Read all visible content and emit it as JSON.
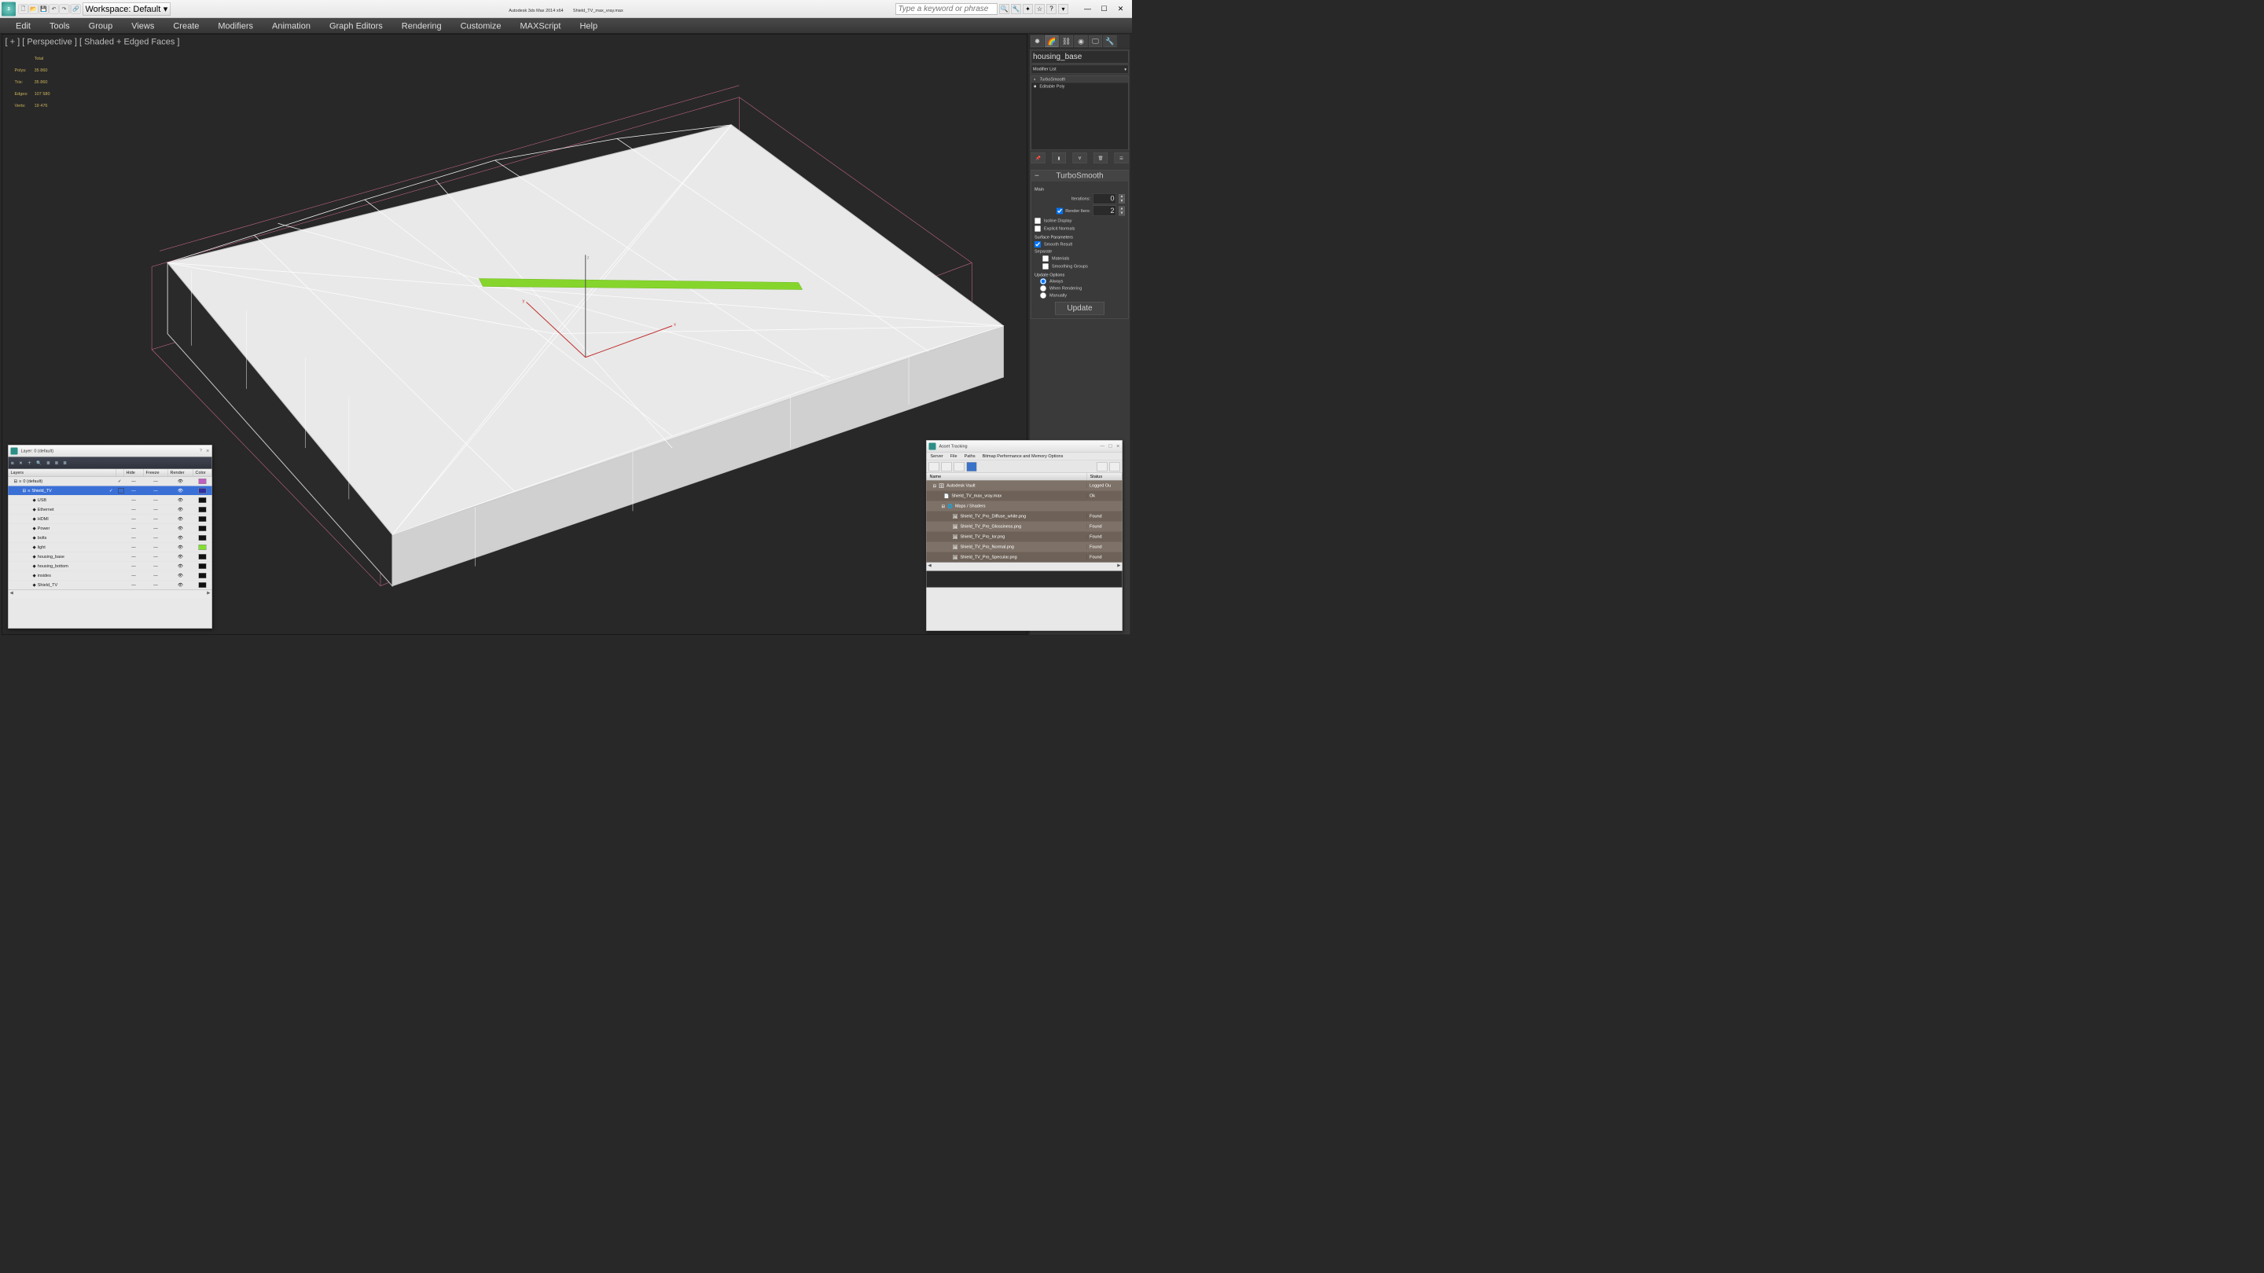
{
  "title": {
    "app": "Autodesk 3ds Max 2014 x64",
    "file": "Shield_TV_max_vray.max"
  },
  "workspace": {
    "label": "Workspace: Default"
  },
  "search": {
    "placeholder": "Type a keyword or phrase"
  },
  "menu": [
    "Edit",
    "Tools",
    "Group",
    "Views",
    "Create",
    "Modifiers",
    "Animation",
    "Graph Editors",
    "Rendering",
    "Customize",
    "MAXScript",
    "Help"
  ],
  "viewport_label": "[ + ] [ Perspective ] [ Shaded + Edged Faces ]",
  "stats": {
    "head": "Total",
    "rows": [
      {
        "k": "Polys:",
        "v": "35 860"
      },
      {
        "k": "Tris:",
        "v": "35 860"
      },
      {
        "k": "Edges:",
        "v": "107 580"
      },
      {
        "k": "Verts:",
        "v": "19 476"
      }
    ]
  },
  "cmd": {
    "object_name": "housing_base",
    "modifier_list": "Modifier List",
    "stack": [
      {
        "icon": "◐",
        "name": "TurboSmooth",
        "sel": true
      },
      {
        "icon": "■",
        "name": "Editable Poly",
        "sel": false
      }
    ],
    "rollout_title": "TurboSmooth",
    "main": "Main",
    "iter_label": "Iterations:",
    "iter_val": "0",
    "render_iter_label": "Render Iters:",
    "render_iter_val": "2",
    "isoline": "Isoline Display",
    "explicit": "Explicit Normals",
    "surface_params": "Surface Parameters",
    "smooth_result": "Smooth Result",
    "separate": "Separate",
    "materials": "Materials",
    "smoothing_groups": "Smoothing Groups",
    "update_options": "Update Options",
    "always": "Always",
    "when_rendering": "When Rendering",
    "manually": "Manually",
    "update": "Update"
  },
  "layers": {
    "title": "Layer: 0 (default)",
    "headers": {
      "layers": "Layers",
      "hide": "Hide",
      "freeze": "Freeze",
      "render": "Render",
      "color": "Color"
    },
    "rows": [
      {
        "indent": 0,
        "exp": "⊟",
        "ic": "≡",
        "name": "0 (default)",
        "chk": true,
        "hide": "—",
        "freeze": "—",
        "render": "👁",
        "color": "#c060c0",
        "sel": false
      },
      {
        "indent": 1,
        "exp": "⊟",
        "ic": "≡",
        "name": "Shield_TV",
        "chk": true,
        "box": true,
        "hide": "—",
        "freeze": "—",
        "render": "👁",
        "color": "#3030a0",
        "sel": true
      },
      {
        "indent": 2,
        "exp": "",
        "ic": "◆",
        "name": "USB",
        "hide": "—",
        "freeze": "—",
        "render": "👁",
        "color": "#101010"
      },
      {
        "indent": 2,
        "exp": "",
        "ic": "◆",
        "name": "Ethernet",
        "hide": "—",
        "freeze": "—",
        "render": "👁",
        "color": "#101010"
      },
      {
        "indent": 2,
        "exp": "",
        "ic": "◆",
        "name": "HDMI",
        "hide": "—",
        "freeze": "—",
        "render": "👁",
        "color": "#101010"
      },
      {
        "indent": 2,
        "exp": "",
        "ic": "◆",
        "name": "Power",
        "hide": "—",
        "freeze": "—",
        "render": "👁",
        "color": "#101010"
      },
      {
        "indent": 2,
        "exp": "",
        "ic": "◆",
        "name": "bolts",
        "hide": "—",
        "freeze": "—",
        "render": "👁",
        "color": "#101010"
      },
      {
        "indent": 2,
        "exp": "",
        "ic": "◆",
        "name": "light",
        "hide": "—",
        "freeze": "—",
        "render": "👁",
        "color": "#80e030"
      },
      {
        "indent": 2,
        "exp": "",
        "ic": "◆",
        "name": "housing_base",
        "hide": "—",
        "freeze": "—",
        "render": "👁",
        "color": "#101010"
      },
      {
        "indent": 2,
        "exp": "",
        "ic": "◆",
        "name": "housing_bottom",
        "hide": "—",
        "freeze": "—",
        "render": "👁",
        "color": "#101010"
      },
      {
        "indent": 2,
        "exp": "",
        "ic": "◆",
        "name": "insides",
        "hide": "—",
        "freeze": "—",
        "render": "👁",
        "color": "#101010"
      },
      {
        "indent": 2,
        "exp": "",
        "ic": "◆",
        "name": "Shield_TV",
        "hide": "—",
        "freeze": "—",
        "render": "👁",
        "color": "#101010"
      }
    ]
  },
  "asset": {
    "title": "Asset Tracking",
    "menu": [
      "Server",
      "File",
      "Paths",
      "Bitmap Performance and Memory Options"
    ],
    "headers": {
      "name": "Name",
      "status": "Status"
    },
    "rows": [
      {
        "indent": 0,
        "exp": "⊟",
        "ic": "🗄",
        "name": "Autodesk Vault",
        "status": "Logged Ou",
        "bg": "bg0"
      },
      {
        "indent": 1,
        "exp": "",
        "ic": "📄",
        "name": "Shield_TV_max_vray.max",
        "status": "Ok",
        "bg": "bg1"
      },
      {
        "indent": 1,
        "exp": "⊟",
        "ic": "🌐",
        "name": "Maps / Shaders",
        "status": "",
        "bg": "bg0"
      },
      {
        "indent": 2,
        "exp": "",
        "ic": "🖼",
        "name": "Shield_TV_Pro_Diffuse_white.png",
        "status": "Found",
        "bg": "bg1"
      },
      {
        "indent": 2,
        "exp": "",
        "ic": "🖼",
        "name": "Shield_TV_Pro_Glossiness.png",
        "status": "Found",
        "bg": "bg0"
      },
      {
        "indent": 2,
        "exp": "",
        "ic": "🖼",
        "name": "Shield_TV_Pro_Ior.png",
        "status": "Found",
        "bg": "bg1"
      },
      {
        "indent": 2,
        "exp": "",
        "ic": "🖼",
        "name": "Shield_TV_Pro_Normal.png",
        "status": "Found",
        "bg": "bg0"
      },
      {
        "indent": 2,
        "exp": "",
        "ic": "🖼",
        "name": "Shield_TV_Pro_Specular.png",
        "status": "Found",
        "bg": "bg1"
      }
    ]
  }
}
